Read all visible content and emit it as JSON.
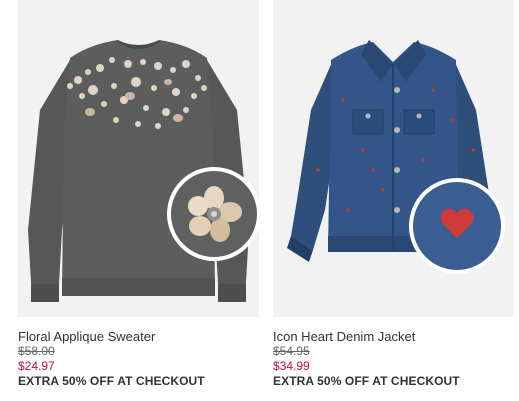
{
  "products": [
    {
      "name": "Floral Applique Sweater",
      "original_price": "$58.00",
      "sale_price": "$24.97",
      "promo": "EXTRA 50% OFF AT CHECKOUT",
      "image_icon": "gray-sequin-sweater-image",
      "zoom_icon": "flower-applique-zoom-image"
    },
    {
      "name": "Icon Heart Denim Jacket",
      "original_price": "$54.95",
      "sale_price": "$34.99",
      "promo": "EXTRA 50% OFF AT CHECKOUT",
      "image_icon": "denim-jacket-image",
      "zoom_icon": "heart-embroidery-zoom-image"
    }
  ],
  "colors": {
    "sale_price": "#c8102e",
    "image_background": "#f2f2f2",
    "sweater": "#5b5b5b",
    "denim": "#2f4f7e"
  }
}
